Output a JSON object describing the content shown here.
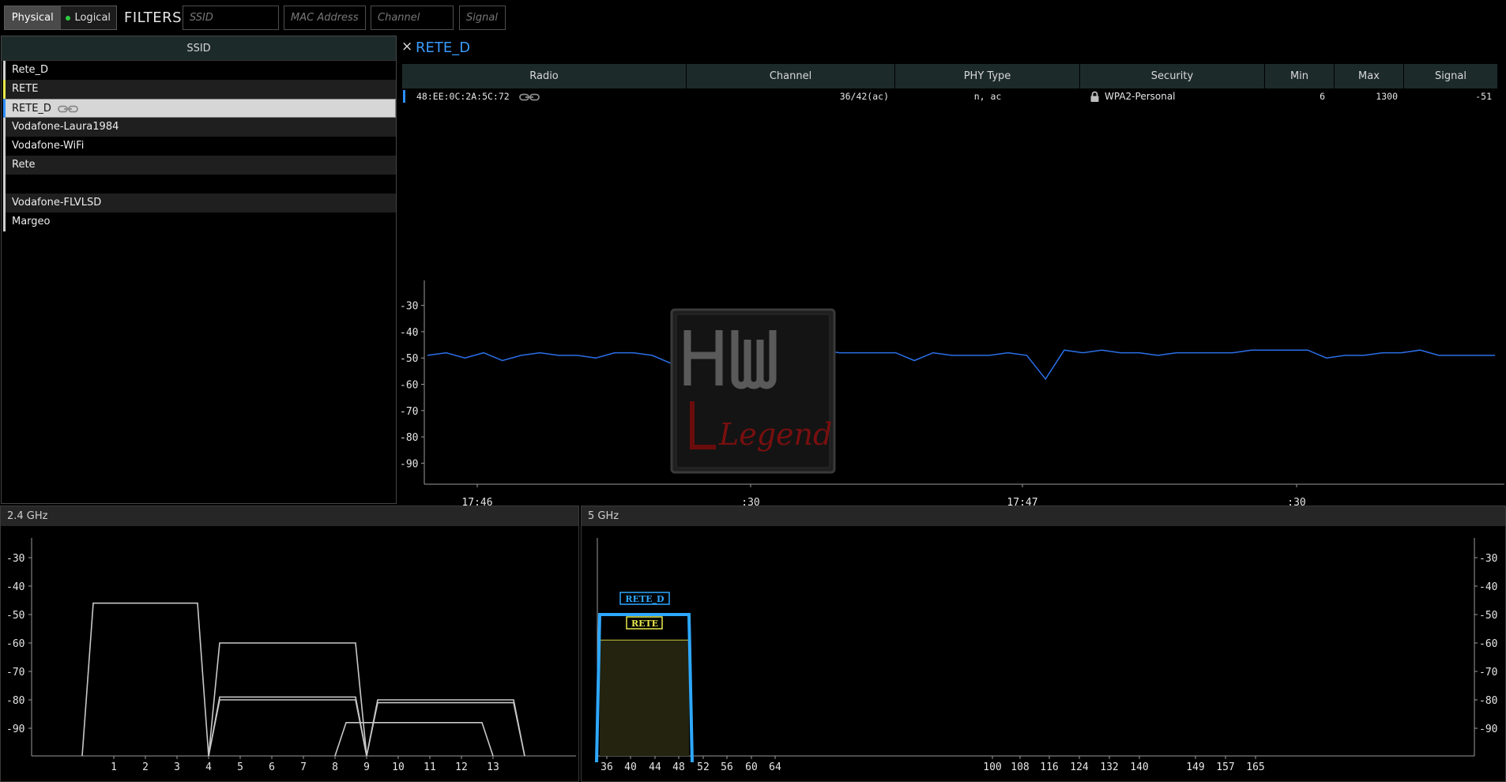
{
  "toolbar": {
    "view_physical": "Physical",
    "view_logical": "Logical",
    "filters_label": "FILTERS:",
    "ssid_placeholder": "SSID",
    "mac_placeholder": "MAC Address",
    "channel_placeholder": "Channel",
    "signal_placeholder": "Signal"
  },
  "ssid_list": {
    "header": "SSID",
    "items": [
      {
        "label": "Rete_D",
        "color": "#cfcfcf"
      },
      {
        "label": "RETE",
        "color": "#e8e84a"
      },
      {
        "label": "RETE_D",
        "color": "#2b8fff",
        "selected": true,
        "icon": "link-icon"
      },
      {
        "label": "Vodafone-Laura1984",
        "color": "#cfcfcf"
      },
      {
        "label": "Vodafone-WiFi",
        "color": "#cfcfcf"
      },
      {
        "label": "Rete",
        "color": "#cfcfcf"
      },
      {
        "label": "",
        "color": "#cfcfcf"
      },
      {
        "label": "Vodafone-FLVLSD",
        "color": "#cfcfcf"
      },
      {
        "label": "Margeo",
        "color": "#cfcfcf"
      }
    ]
  },
  "detail": {
    "close_glyph": "×",
    "title": "RETE_D",
    "columns": [
      "Radio",
      "Channel",
      "PHY Type",
      "Security",
      "Min",
      "Max",
      "Signal"
    ],
    "row": {
      "radio": "48:EE:0C:2A:5C:72",
      "channel": "36/42(ac)",
      "phy": "n, ac",
      "security": "WPA2-Personal",
      "min": "6",
      "max": "1300",
      "signal": "-51",
      "accent": "#2b8fff",
      "radio_icon": "link-icon",
      "security_icon": "lock-icon"
    }
  },
  "signal_history": {
    "type": "line",
    "color": "#2b6fe8",
    "y_ticks": [
      "-30",
      "-40",
      "-50",
      "-60",
      "-70",
      "-80",
      "-90"
    ],
    "ylim": [
      -98,
      -22
    ],
    "x_ticks": [
      "17:46",
      ":30",
      "17:47",
      ":30"
    ],
    "values": [
      -49,
      -48,
      -50,
      -48,
      -51,
      -49,
      -48,
      -49,
      -49,
      -50,
      -48,
      -48,
      -49,
      -52,
      -50,
      -52,
      -49,
      -49,
      -49,
      -48,
      -48,
      -47,
      -48,
      -48,
      -48,
      -48,
      -51,
      -48,
      -49,
      -49,
      -49,
      -48,
      -49,
      -58,
      -47,
      -48,
      -47,
      -48,
      -48,
      -49,
      -48,
      -48,
      -48,
      -48,
      -47,
      -47,
      -47,
      -47,
      -50,
      -49,
      -49,
      -48,
      -48,
      -47,
      -49,
      -49,
      -49,
      -49
    ]
  },
  "watermark": {
    "text_main": "HW",
    "text_sub": "Legend"
  },
  "band_24": {
    "title": "2.4 GHz",
    "y_ticks": [
      "-30",
      "-40",
      "-50",
      "-60",
      "-70",
      "-80",
      "-90"
    ],
    "ylim": [
      -100,
      -25
    ],
    "x_ticks": [
      "1",
      "2",
      "3",
      "4",
      "5",
      "6",
      "7",
      "8",
      "9",
      "10",
      "11",
      "12",
      "13"
    ],
    "networks": [
      {
        "from": 0,
        "to": 4,
        "signal": -46,
        "color": "#c8c8c8"
      },
      {
        "from": 4,
        "to": 9,
        "signal": -60,
        "color": "#c8c8c8"
      },
      {
        "from": 4,
        "to": 9,
        "signal": -79,
        "color": "#c8c8c8"
      },
      {
        "from": 4,
        "to": 9,
        "signal": -80,
        "color": "#c8c8c8"
      },
      {
        "from": 8,
        "to": 13,
        "signal": -88,
        "color": "#c8c8c8"
      },
      {
        "from": 9,
        "to": 14,
        "signal": -80,
        "color": "#c8c8c8"
      },
      {
        "from": 9,
        "to": 14,
        "signal": -81,
        "color": "#c8c8c8"
      }
    ]
  },
  "band_5": {
    "title": "5 GHz",
    "y_ticks": [
      "-30",
      "-40",
      "-50",
      "-60",
      "-70",
      "-80",
      "-90"
    ],
    "ylim": [
      -100,
      -25
    ],
    "x_ticks": [
      "36",
      "40",
      "44",
      "48",
      "52",
      "56",
      "60",
      "64",
      "100",
      "108",
      "116",
      "124",
      "132",
      "140",
      "149",
      "157",
      "165"
    ],
    "networks": [
      {
        "label": "RETE_D",
        "signal": -50,
        "color": "#2ea8ff"
      },
      {
        "label": "RETE",
        "signal": -59,
        "color": "#e8e84a"
      }
    ]
  }
}
